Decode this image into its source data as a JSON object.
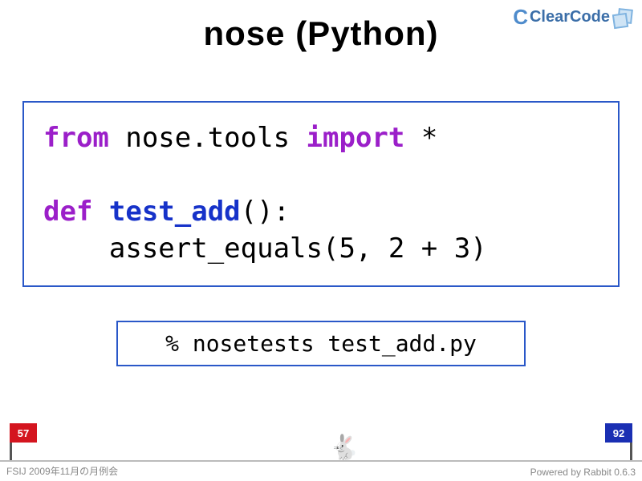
{
  "title": "nose (Python)",
  "logo": {
    "brand": "ClearCode"
  },
  "code": {
    "l1_kw1": "from",
    "l1_mid": " nose.tools ",
    "l1_kw2": "import",
    "l1_end": " *",
    "l3_kw": "def ",
    "l3_fn": "test_add",
    "l3_end": "():",
    "l4": "    assert_equals(5, 2 + 3)"
  },
  "command": "% nosetests test_add.py",
  "flags": {
    "left": "57",
    "right": "92"
  },
  "footer": {
    "left": "FSIJ 2009年11月の月例会",
    "right": "Powered by Rabbit 0.6.3"
  },
  "rabbit_glyph": "🐇"
}
